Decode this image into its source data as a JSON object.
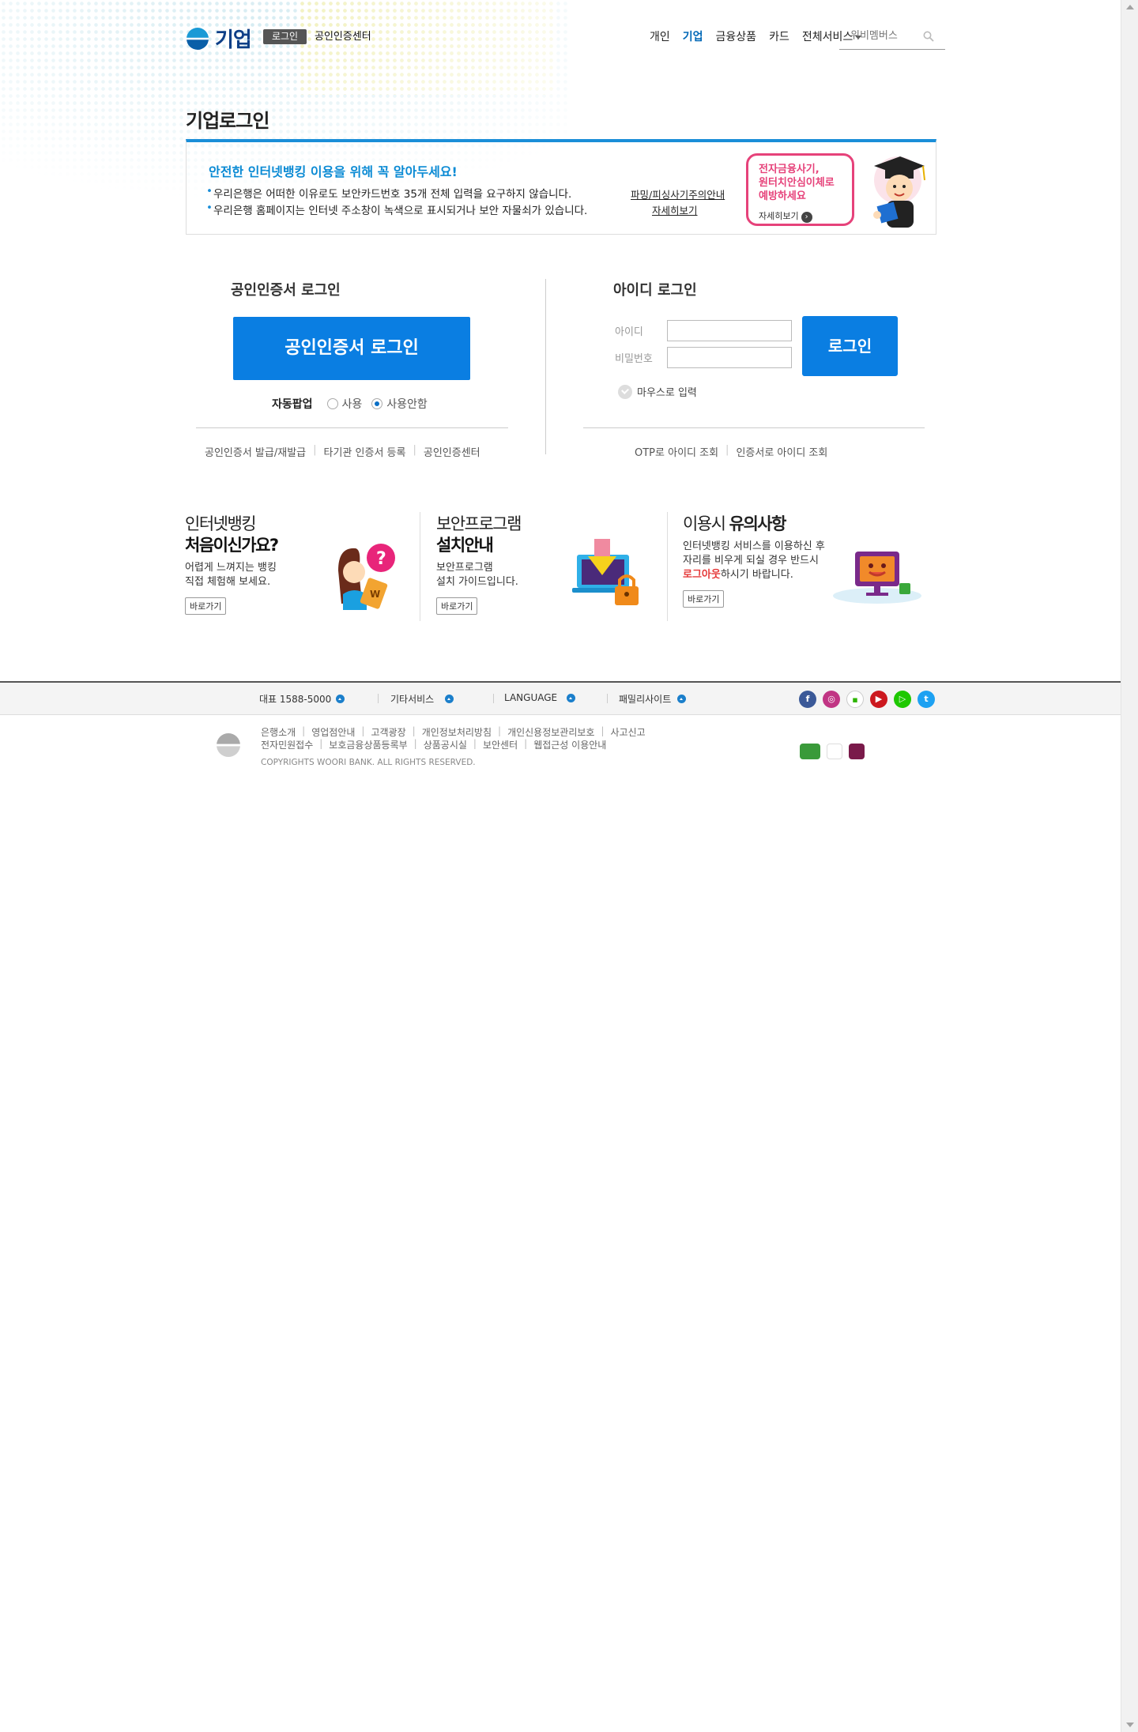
{
  "header": {
    "logo_text": "기업",
    "login_badge": "로그인",
    "cert_center_link": "공인인증센터",
    "nav": [
      "개인",
      "기업",
      "금융상품",
      "카드"
    ],
    "nav_all_services": "전체서비스",
    "search_placeholder": "위비멤버스"
  },
  "page_title": "기업로그인",
  "notice": {
    "title": "안전한 인터넷뱅킹 이용을 위해 꼭 알아두세요!",
    "line1": "우리은행은 어떠한 이유로도 보안카드번호 35개 전체 입력을 요구하지 않습니다.",
    "line1_link": "파밍/피싱사기주의안내",
    "line2": "우리은행 홈페이지는 인터넷 주소창이 녹색으로 표시되거나 보안 자물쇠가 있습니다.",
    "line2_link": "자세히보기",
    "banner_line1": "전자금융사기,",
    "banner_line2": "원터치안심이체로",
    "banner_line3": "예방하세요",
    "banner_more": "자세히보기"
  },
  "cert_login": {
    "title": "공인인증서 로그인",
    "button": "공인인증서 로그인",
    "auto_popup_label": "자동팝업",
    "option_use": "사용",
    "option_no_use": "사용안함",
    "selected": "사용안함",
    "links": [
      "공인인증서 발급/재발급",
      "타기관 인증서 등록",
      "공인인증센터"
    ]
  },
  "id_login": {
    "title": "아이디 로그인",
    "id_label": "아이디",
    "pw_label": "비밀번호",
    "button": "로그인",
    "mouse_input": "마우스로 입력",
    "links": [
      "OTP로 아이디 조회",
      "인증서로 아이디 조회"
    ]
  },
  "promos": [
    {
      "h1": "인터넷뱅킹",
      "h2": "처음이신가요?",
      "desc1": "어렵게 느껴지는 뱅킹",
      "desc2": "직접 체험해 보세요.",
      "go": "바로가기"
    },
    {
      "h1": "보안프로그램",
      "h2": "설치안내",
      "desc1": "보안프로그램",
      "desc2": "설치 가이드입니다.",
      "go": "바로가기"
    },
    {
      "h1": "이용시",
      "h2": "유의사항",
      "desc1": "인터넷뱅킹 서비스를 이용하신 후",
      "desc2": "자리를 비우게 되실 경우 반드시",
      "desc3_em": "로그아웃",
      "desc3": "하시기 바랍니다.",
      "go": "바로가기"
    }
  ],
  "footer": {
    "bar": [
      "대표 1588-5000",
      "기타서비스",
      "LANGUAGE",
      "패밀리사이트"
    ],
    "links_row1": [
      "은행소개",
      "영업점안내",
      "고객광장",
      "개인정보처리방침",
      "개인신용정보관리보호",
      "사고신고"
    ],
    "links_row2": [
      "전자민원접수",
      "보호금융상품등록부",
      "상품공시실",
      "보안센터",
      "웹접근성 이용안내"
    ],
    "copyright": "COPYRIGHTS WOORI BANK. ALL RIGHTS RESERVED."
  },
  "colors": {
    "primary_blue": "#0a7ee2",
    "notice_blue": "#1a8ed8",
    "accent_pink": "#e6427a",
    "navy": "#0e3f87"
  }
}
